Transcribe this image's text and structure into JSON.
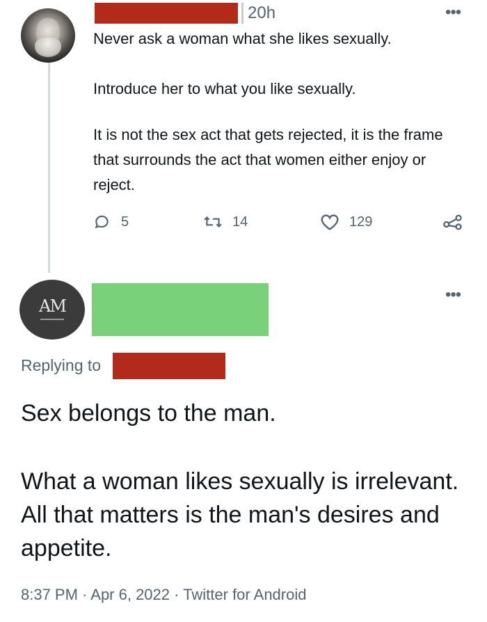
{
  "tweet": {
    "time": "20h",
    "more": "•••",
    "paragraphs": [
      "Never ask a woman what she likes sexually.",
      "Introduce her to what you like sexually.",
      "It is not the sex act that gets rejected, it is the frame that surrounds the act that women either enjoy or reject."
    ],
    "actions": {
      "replies": "5",
      "retweets": "14",
      "likes": "129"
    }
  },
  "reply": {
    "avatar_text": "AM",
    "more": "•••",
    "replying_label": "Replying to",
    "paragraphs": [
      "Sex belongs to the man.",
      "What a woman likes sexually is irrelevant. All that matters is the man's desires and appetite."
    ],
    "meta": "8:37 PM · Apr 6, 2022 · Twitter for Android"
  },
  "colors": {
    "redaction_red": "#b12a1a",
    "redaction_green": "#79d179",
    "secondary_text": "#536471",
    "thread_line": "#cfd9de"
  }
}
